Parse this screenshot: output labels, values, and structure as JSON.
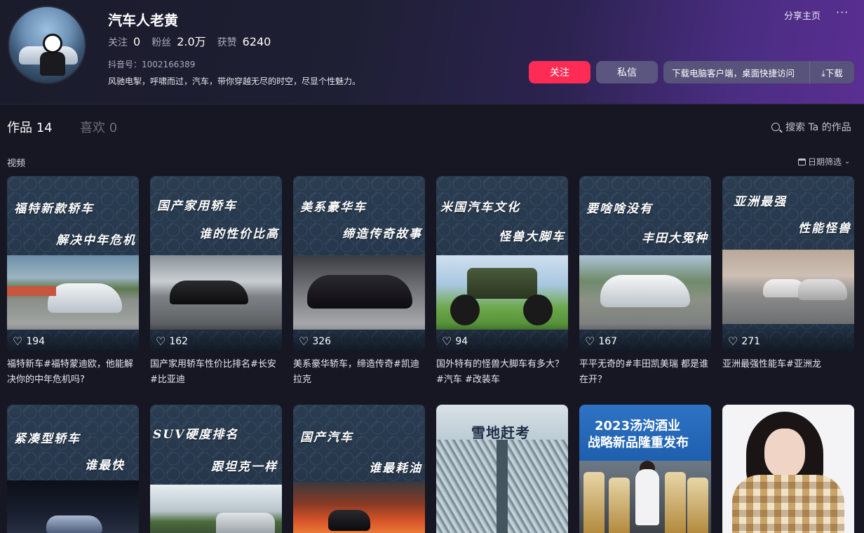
{
  "profile": {
    "name": "汽车人老黄",
    "follow_label": "关注",
    "follow_count": "0",
    "fans_label": "粉丝",
    "fans_count": "2.0万",
    "likes_label": "获赞",
    "likes_count": "6240",
    "douyin_id": "抖音号：1002166389",
    "bio": "风驰电掣，呼啸而过，汽车，带你穿越无尽的时空，尽显个性魅力。"
  },
  "header_actions": {
    "share_home": "分享主页",
    "more": "···",
    "follow_button": "关注",
    "message_button": "私信",
    "download_text": "下载电脑客户端，桌面快捷访问",
    "download_button": "⤓下载"
  },
  "tabs": {
    "works": "作品 14",
    "likes": "喜欢 0",
    "search": "搜索 Ta 的作品"
  },
  "section": {
    "label": "视频",
    "date_filter": "日期筛选"
  },
  "colors": {
    "accent": "#fe2c55",
    "secondary_button": "#5a5680",
    "background": "#161722"
  },
  "videos": [
    {
      "cap1": "福特新款轿车",
      "cap2": "解决中年危机",
      "likes": "194",
      "title": "福特新车#福特蒙迪欧，他能解决你的中年危机吗?"
    },
    {
      "cap1": "国产家用轿车",
      "cap2": "谁的性价比高",
      "likes": "162",
      "title": "国产家用轿车性价比排名#长安 #比亚迪"
    },
    {
      "cap1": "美系豪华车",
      "cap2": "缔造传奇故事",
      "likes": "326",
      "title": "美系豪华轿车，缔造传奇#凯迪拉克"
    },
    {
      "cap1": "米国汽车文化",
      "cap2": "怪兽大脚车",
      "likes": "94",
      "title": "国外特有的怪兽大脚车有多大？#汽车 #改装车"
    },
    {
      "cap1": "要啥啥没有",
      "cap2": "丰田大冤种",
      "likes": "167",
      "title": "平平无奇的#丰田凯美瑞 都是谁在开？"
    },
    {
      "cap1": "亚洲最强",
      "cap2": "性能怪兽",
      "likes": "271",
      "title": "亚洲最强性能车#亚洲龙"
    },
    {
      "cap1": "紧凑型轿车",
      "cap2": "谁最快"
    },
    {
      "cap1": "SUV硬度排名",
      "cap2": "跟坦克一样"
    },
    {
      "cap1": "国产汽车",
      "cap2": "谁最耗油"
    },
    {
      "cap1": "雪地赶考"
    },
    {
      "cap1": "2023汤沟酒业",
      "cap2": "战略新品隆重发布"
    }
  ]
}
